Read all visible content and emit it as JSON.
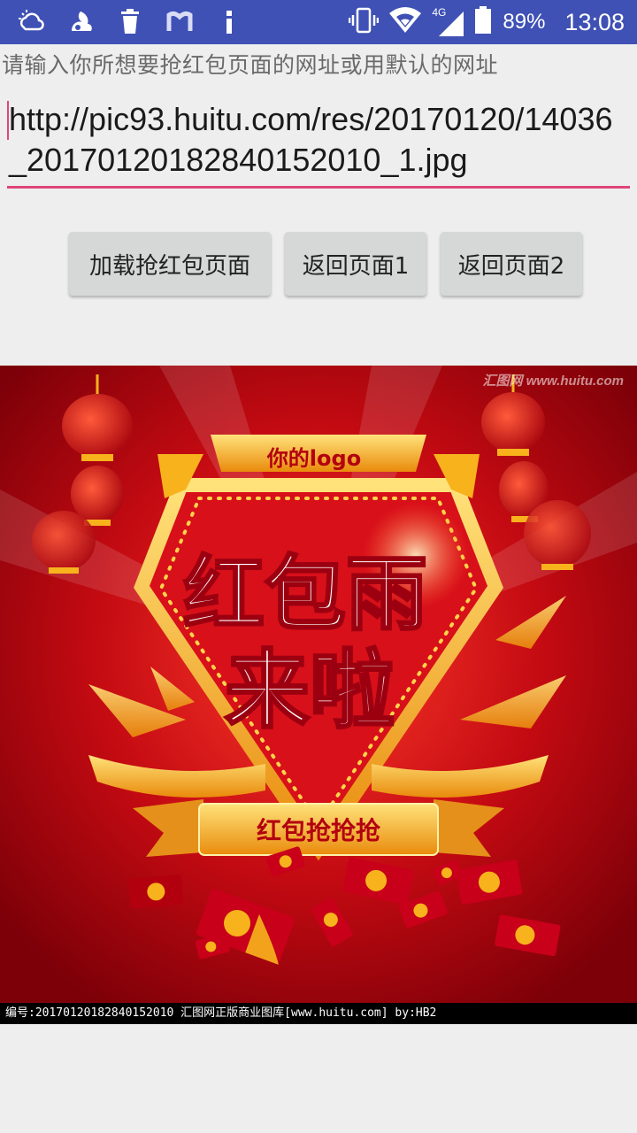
{
  "status_bar": {
    "notification_icons": [
      "weather-cloud-sun-icon",
      "uc-browser-squirrel-icon",
      "trash-icon",
      "m-app-icon",
      "info-icon"
    ],
    "right_icons": [
      "vibrate-icon",
      "wifi-icon",
      "signal-4g-icon",
      "battery-icon"
    ],
    "network_label": "4G",
    "battery_percent": "89%",
    "time": "13:08"
  },
  "prompt_label": "请输入你所想要抢红包页面的网址或用默认的网址",
  "url_input": {
    "value": "http://pic93.huitu.com/res/20170120/14036_20170120182840152010_1.jpg"
  },
  "buttons": {
    "load": "加载抢红包页面",
    "back1": "返回页面1",
    "back2": "返回页面2"
  },
  "poster": {
    "watermark": "汇图网 www.huitu.com",
    "logo_text": "你的logo",
    "headline_line1": "红包雨",
    "headline_line2": "来啦",
    "ribbon_text": "红包抢抢抢",
    "caption": "编号:20170120182840152010  汇图网正版商业图库[www.huitu.com] by:HB2",
    "colors": {
      "background": "#b3000f",
      "gold": "#f7b21c",
      "ribbon": "#f2a31b"
    }
  },
  "accent_color": "#e0457b",
  "status_bar_color": "#3f51b5"
}
